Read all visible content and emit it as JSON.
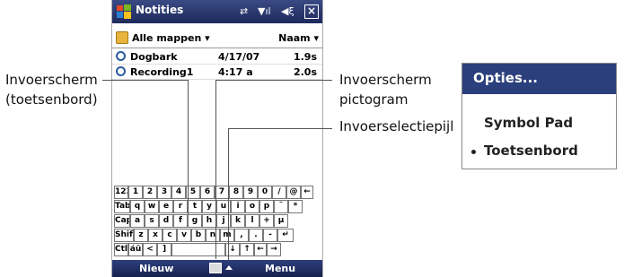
{
  "device": {
    "title": "Notities",
    "toolbar": {
      "folder": "Alle mappen ▾",
      "sort": "Naam ▾"
    },
    "recordings": [
      {
        "name": "Dogbark",
        "date": "4/17/07",
        "duration": "1.9s"
      },
      {
        "name": "Recording1",
        "date": "4:17 a",
        "duration": "2.0s"
      }
    ],
    "keyboard": [
      [
        "123",
        "1",
        "2",
        "3",
        "4",
        "5",
        "6",
        "7",
        "8",
        "9",
        "0",
        "/",
        "@",
        "←"
      ],
      [
        "Tab",
        "q",
        "w",
        "e",
        "r",
        "t",
        "y",
        "u",
        "i",
        "o",
        "p",
        "¨",
        "*"
      ],
      [
        "Cap",
        "a",
        "s",
        "d",
        "f",
        "g",
        "h",
        "j",
        "k",
        "l",
        "+",
        "µ"
      ],
      [
        "Shift",
        "z",
        "x",
        "c",
        "v",
        "b",
        "n",
        "m",
        ",",
        ".",
        "-",
        "↵"
      ],
      [
        "Ctl",
        "áü",
        "<",
        "]",
        "",
        "↓",
        "↑",
        "←",
        "→"
      ]
    ],
    "menubar": {
      "left": "Nieuw",
      "right": "Menu"
    }
  },
  "callouts": {
    "input_panel": "Invoerscherm\n(toetsenbord)",
    "input_icon": "Invoerscherm\npictogram",
    "selector_arrow": "Invoerselectiepijl"
  },
  "options_menu": {
    "title": "Opties...",
    "items": [
      "Symbol Pad",
      "Toetsenbord"
    ],
    "selected": "Toetsenbord"
  },
  "colors": {
    "titlebar": "#1e2a5c",
    "options_header": "#2b3f7c"
  }
}
